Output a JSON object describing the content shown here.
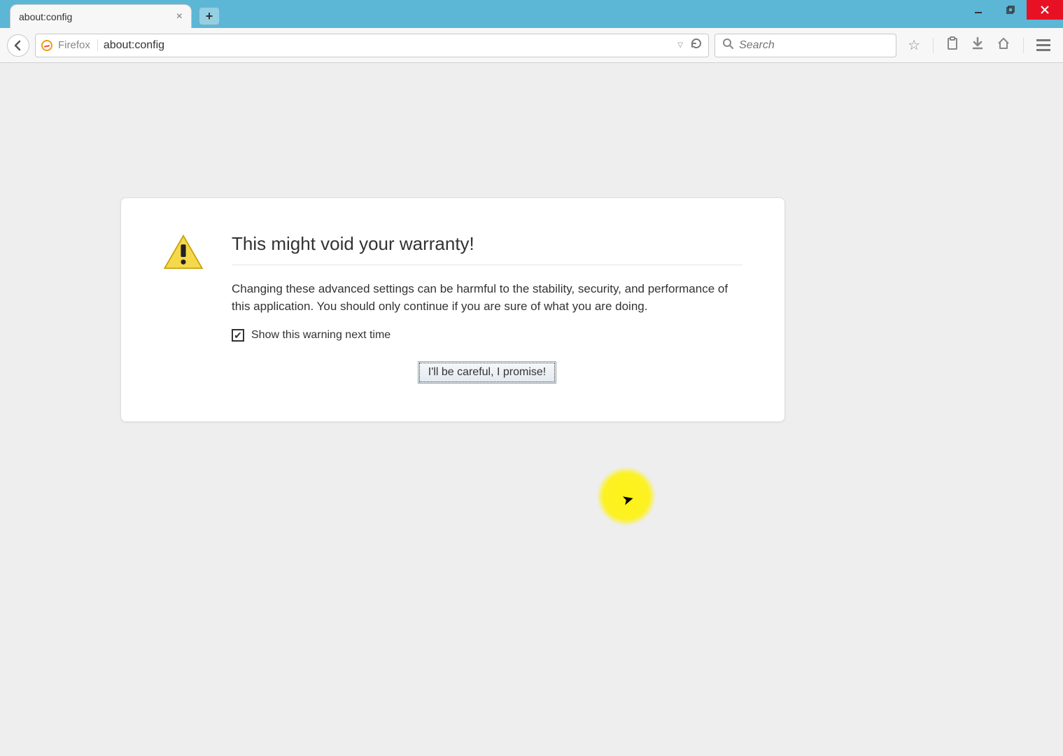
{
  "tab": {
    "title": "about:config"
  },
  "toolbar": {
    "brand": "Firefox",
    "url": "about:config",
    "search_placeholder": "Search"
  },
  "warning": {
    "title": "This might void your warranty!",
    "body": "Changing these advanced settings can be harmful to the stability, security, and performance of this application. You should only continue if you are sure of what you are doing.",
    "checkbox_label": "Show this warning next time",
    "button_label": "I'll be careful, I promise!"
  }
}
